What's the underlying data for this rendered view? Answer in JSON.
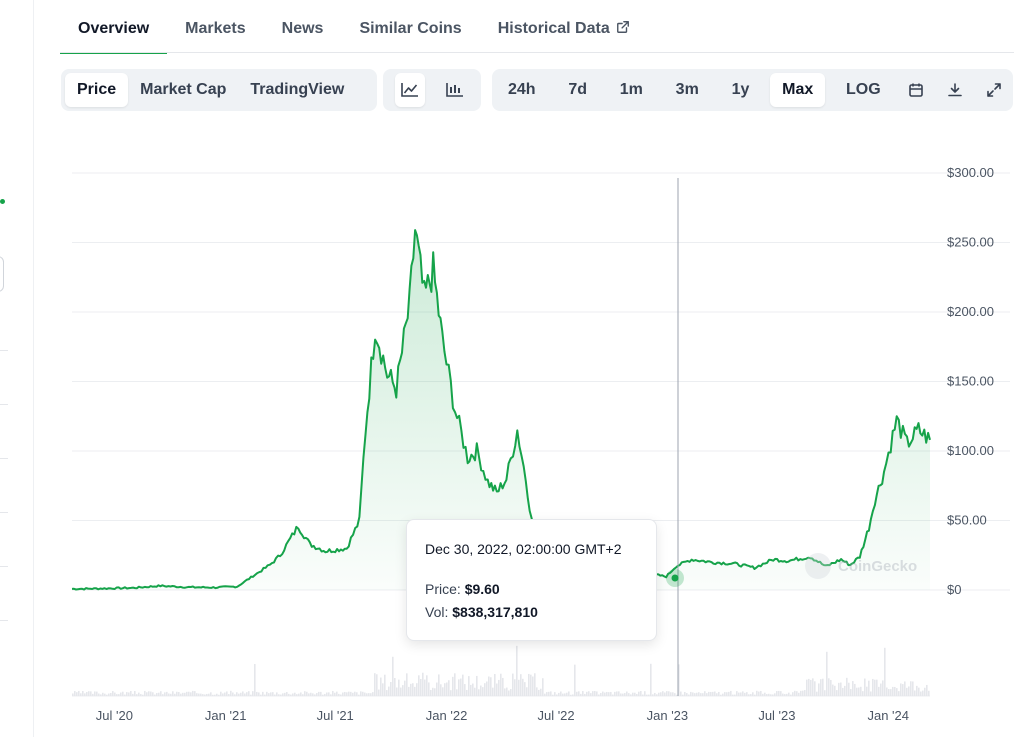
{
  "tabs": {
    "items": [
      {
        "label": "Overview"
      },
      {
        "label": "Markets"
      },
      {
        "label": "News"
      },
      {
        "label": "Similar Coins"
      },
      {
        "label": "Historical Data"
      }
    ]
  },
  "toolbar": {
    "view": {
      "price": "Price",
      "market_cap": "Market Cap",
      "tradingview": "TradingView"
    },
    "chart_style": {
      "line_icon": "line-chart-icon",
      "candle_icon": "candlestick-icon"
    },
    "ranges": {
      "d24h": "24h",
      "d7d": "7d",
      "m1": "1m",
      "m3": "3m",
      "y1": "1y",
      "max": "Max",
      "log": "LOG"
    },
    "action_icons": {
      "calendar": "calendar-icon",
      "download": "download-icon",
      "expand": "expand-icon"
    }
  },
  "tooltip": {
    "date": "Dec 30, 2022, 02:00:00 GMT+2",
    "price_label": "Price:",
    "price_value": "$9.60",
    "vol_label": "Vol:",
    "vol_value": "$838,317,810"
  },
  "watermark": "CoinGecko",
  "colors": {
    "accent": "#16a34a",
    "line": "#16a34a",
    "fill": "#dcfce7",
    "grid": "#eceef1"
  },
  "chart_data": {
    "type": "area",
    "title": "",
    "xlabel": "",
    "ylabel": "",
    "x_tick_labels": [
      "Jul '20",
      "Jan '21",
      "Jul '21",
      "Jan '22",
      "Jul '22",
      "Jan '23",
      "Jul '23",
      "Jan '24"
    ],
    "y_tick_labels": [
      "$300.00",
      "$250.00",
      "$200.00",
      "$150.00",
      "$100.00",
      "$50.00",
      "$0"
    ],
    "ylim": [
      0,
      300
    ],
    "grid": true,
    "series": [
      {
        "x": [
          "2020-04-22",
          "2020-06-01",
          "2020-08-01",
          "2020-09-15",
          "2020-11-01",
          "2020-12-15",
          "2021-01-20",
          "2021-02-15",
          "2021-03-15",
          "2021-04-01",
          "2021-05-01",
          "2021-05-20",
          "2021-06-15",
          "2021-07-20",
          "2021-08-10",
          "2021-08-20",
          "2021-09-05",
          "2021-09-25",
          "2021-10-10",
          "2021-11-01",
          "2021-11-10",
          "2021-11-25",
          "2021-12-10",
          "2021-12-25",
          "2022-01-15",
          "2022-02-05",
          "2022-02-20",
          "2022-03-10",
          "2022-03-25",
          "2022-04-10",
          "2022-04-28",
          "2022-05-12",
          "2022-05-25",
          "2022-06-10",
          "2022-06-25",
          "2022-08-01",
          "2022-09-15",
          "2022-11-01",
          "2022-12-01",
          "2022-12-30",
          "2023-01-15",
          "2023-02-10",
          "2023-03-15",
          "2023-04-20",
          "2023-05-25",
          "2023-06-25",
          "2023-07-20",
          "2023-08-25",
          "2023-09-20",
          "2023-10-15",
          "2023-10-30",
          "2023-11-15",
          "2023-11-30",
          "2023-12-10",
          "2023-12-25",
          "2024-01-05",
          "2024-01-15",
          "2024-02-01",
          "2024-02-20",
          "2024-03-10"
        ],
        "y": [
          0.8,
          1.0,
          1.5,
          3,
          2,
          1.8,
          2.5,
          10,
          18,
          25,
          46,
          33,
          28,
          30,
          50,
          115,
          190,
          155,
          145,
          205,
          259,
          210,
          230,
          180,
          130,
          95,
          100,
          78,
          70,
          80,
          115,
          80,
          40,
          25,
          35,
          20,
          15,
          14,
          12,
          9.6,
          17,
          22,
          20,
          19,
          16,
          22,
          21,
          24,
          17,
          22,
          18,
          24,
          45,
          65,
          85,
          105,
          122,
          105,
          115,
          108
        ]
      }
    ]
  }
}
